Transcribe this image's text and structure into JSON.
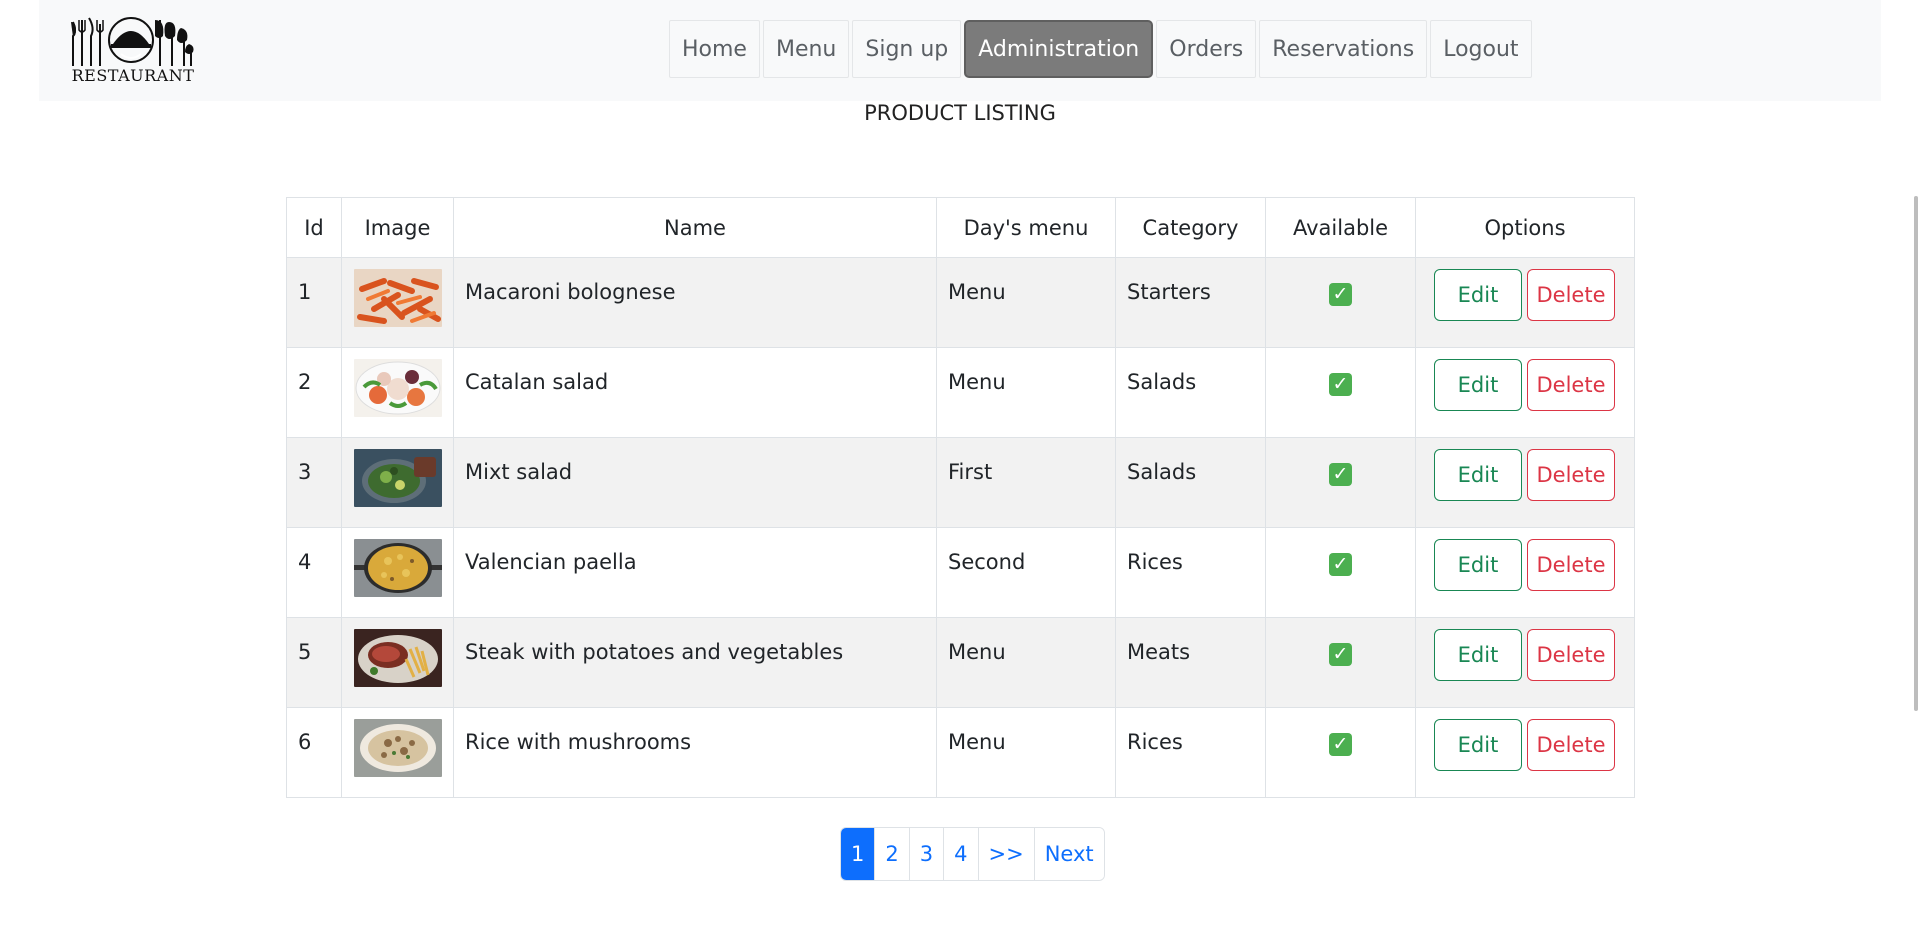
{
  "logo": {
    "text": "RESTAURANT"
  },
  "nav": [
    {
      "label": "Home",
      "active": false
    },
    {
      "label": "Menu",
      "active": false
    },
    {
      "label": "Sign up",
      "active": false
    },
    {
      "label": "Administration",
      "active": true
    },
    {
      "label": "Orders",
      "active": false
    },
    {
      "label": "Reservations",
      "active": false
    },
    {
      "label": "Logout",
      "active": false
    }
  ],
  "page": {
    "title": "PRODUCT LISTING"
  },
  "table": {
    "headers": [
      "Id",
      "Image",
      "Name",
      "Day's menu",
      "Category",
      "Available",
      "Options"
    ],
    "rows": [
      {
        "id": "1",
        "image": "macaroni-photo",
        "name": "Macaroni bolognese",
        "day_menu": "Menu",
        "category": "Starters",
        "available": "✓"
      },
      {
        "id": "2",
        "image": "catalan-salad-photo",
        "name": "Catalan salad",
        "day_menu": "Menu",
        "category": "Salads",
        "available": "✓"
      },
      {
        "id": "3",
        "image": "mixt-salad-photo",
        "name": "Mixt salad",
        "day_menu": "First",
        "category": "Salads",
        "available": "✓"
      },
      {
        "id": "4",
        "image": "paella-photo",
        "name": "Valencian paella",
        "day_menu": "Second",
        "category": "Rices",
        "available": "✓"
      },
      {
        "id": "5",
        "image": "steak-photo",
        "name": "Steak with potatoes and vegetables",
        "day_menu": "Menu",
        "category": "Meats",
        "available": "✓"
      },
      {
        "id": "6",
        "image": "rice-mushrooms-photo",
        "name": "Rice with mushrooms",
        "day_menu": "Menu",
        "category": "Rices",
        "available": "✓"
      }
    ],
    "edit_label": "Edit",
    "delete_label": "Delete"
  },
  "pagination": [
    {
      "label": "1",
      "active": true
    },
    {
      "label": "2",
      "active": false
    },
    {
      "label": "3",
      "active": false
    },
    {
      "label": "4",
      "active": false
    },
    {
      "label": ">>",
      "active": false
    },
    {
      "label": "Next",
      "active": false
    }
  ],
  "colors": {
    "primary": "#0d6efd",
    "success": "#198754",
    "danger": "#dc3545",
    "active_nav": "#7b7b7b"
  }
}
